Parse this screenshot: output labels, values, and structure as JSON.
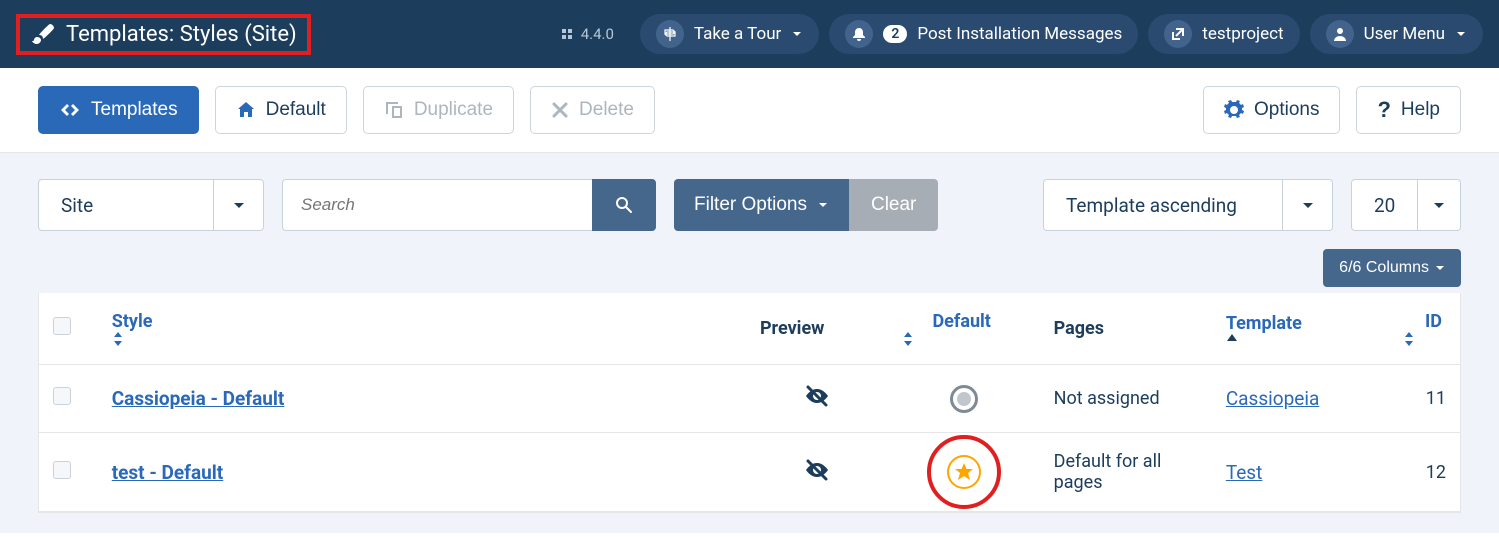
{
  "header": {
    "page_title": "Templates: Styles (Site)",
    "version": "4.4.0",
    "tour_label": "Take a Tour",
    "notif_count": "2",
    "post_install_label": "Post Installation Messages",
    "site_name": "testproject",
    "user_menu_label": "User Menu"
  },
  "toolbar": {
    "templates": "Templates",
    "default": "Default",
    "duplicate": "Duplicate",
    "delete": "Delete",
    "options": "Options",
    "help": "Help"
  },
  "filters": {
    "client_selected": "Site",
    "search_placeholder": "Search",
    "filter_options": "Filter Options",
    "clear": "Clear",
    "sort_selected": "Template ascending",
    "limit_selected": "20",
    "columns_label": "6/6 Columns"
  },
  "table": {
    "headers": {
      "style": "Style",
      "preview": "Preview",
      "default": "Default",
      "pages": "Pages",
      "template": "Template",
      "id": "ID"
    },
    "rows": [
      {
        "style": "Cassiopeia - Default",
        "is_default": false,
        "pages": "Not assigned",
        "template": "Cassiopeia",
        "id": "11"
      },
      {
        "style": "test - Default",
        "is_default": true,
        "pages": "Default for all pages",
        "template": "Test",
        "id": "12"
      }
    ]
  }
}
